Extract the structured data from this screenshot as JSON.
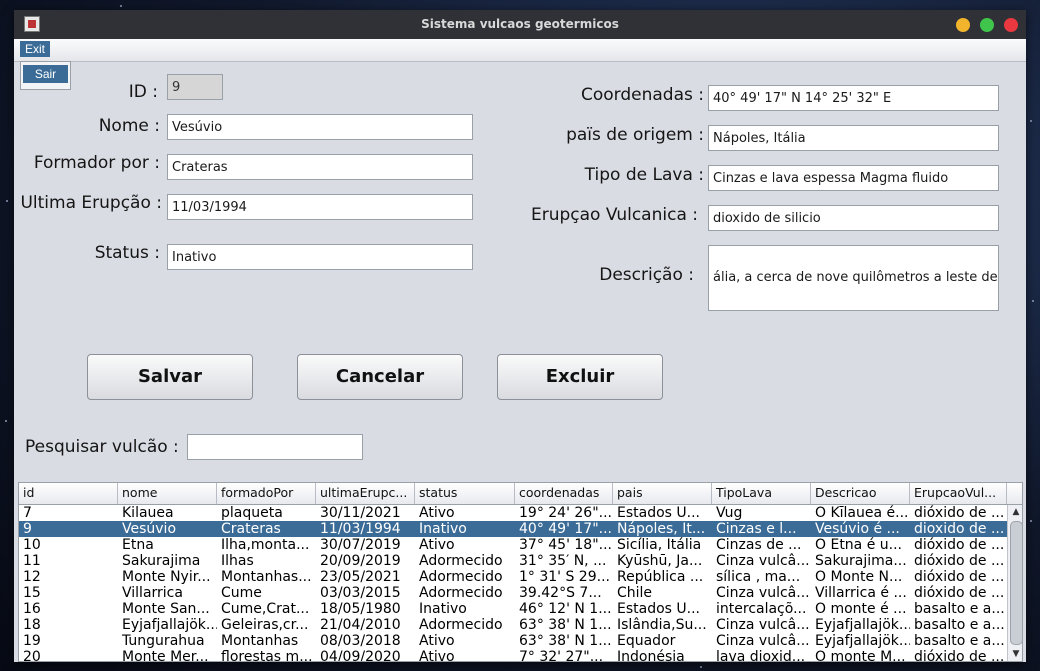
{
  "window": {
    "title": "Sistema vulcaos geotermicos"
  },
  "menu": {
    "exit_label": "Exit",
    "sair_label": "Sair"
  },
  "form": {
    "id": {
      "label": "ID :",
      "value": "9"
    },
    "nome": {
      "label": "Nome :",
      "value": "Vesúvio"
    },
    "formador": {
      "label": "Formador por :",
      "value": "Crateras"
    },
    "ultima": {
      "label": "Ultima Erupção :",
      "value": "11/03/1994"
    },
    "status": {
      "label": "Status :",
      "value": "Inativo"
    },
    "coordenadas": {
      "label": "Coordenadas :",
      "value": "40° 49' 17\" N 14° 25' 32\" E"
    },
    "pais": {
      "label": "païs de origem :",
      "value": "Nápoles, Itália"
    },
    "tipo": {
      "label": "Tipo de Lava :",
      "value": " Cinzas e lava espessa Magma fluido"
    },
    "erupcao": {
      "label": "Erupçao Vulcanica :",
      "value": "dioxido de silicio"
    },
    "descricao": {
      "label": "Descrição :",
      "value": "ália, a cerca de nove quilômetros a leste de"
    }
  },
  "buttons": {
    "salvar": "Salvar",
    "cancelar": "Cancelar",
    "excluir": "Excluir"
  },
  "search": {
    "label": "Pesquisar vulcão :",
    "value": ""
  },
  "table": {
    "columns": [
      "id",
      "nome",
      "formadoPor",
      "ultimaErupc...",
      "status",
      "coordenadas",
      "pais",
      "TipoLava",
      "Descricao",
      "ErupcaoVul..."
    ],
    "rows": [
      [
        "7",
        "Kilauea",
        "plaqueta",
        "30/11/2021",
        "Ativo",
        "19° 24' 26\"...",
        "Estados U...",
        "Vug",
        "O Kīlauea é...",
        "dióxido de ..."
      ],
      [
        "9",
        "Vesúvio",
        "Crateras",
        "11/03/1994",
        "Inativo",
        "40° 49' 17\"...",
        "Nápoles, It...",
        "Cinzas e l...",
        "Vesúvio é ...",
        "dioxido de ..."
      ],
      [
        "10",
        "Etna",
        "Ilha,monta...",
        "30/07/2019",
        "Ativo",
        "37° 45' 18\"...",
        "Sicília, Itália",
        "Cinzas de ...",
        "O Etna é u...",
        "dióxido de ..."
      ],
      [
        "11",
        "Sakurajima",
        "Ilhas",
        "20/09/2019",
        "Adormecido",
        "31° 35′ N, ...",
        "Kyūshū, Ja...",
        "Cinza vulcâ...",
        "Sakurajima...",
        "dióxido de ..."
      ],
      [
        "12",
        "Monte Nyir...",
        "Montanhas...",
        "23/05/2021",
        "Adormecido",
        "1° 31' S 29...",
        "República ...",
        "sílica , ma...",
        "O Monte N...",
        "dióxido de ..."
      ],
      [
        "15",
        "Villarrica",
        "Cume",
        "03/03/2015",
        "Adormecido",
        "39.42°S 7...",
        "Chile",
        "Cinza vulcâ...",
        "Villarrica é ...",
        "dióxido de ..."
      ],
      [
        "16",
        "Monte San...",
        "Cume,Crat...",
        "18/05/1980",
        "Inativo",
        "46° 12' N 1...",
        "Estados U...",
        "intercalaçõ...",
        "O monte é ...",
        "basalto e a..."
      ],
      [
        "18",
        "Eyjafjallajök...",
        "Geleiras,cr...",
        "21/04/2010",
        "Adormecido",
        "63° 38' N 1...",
        "Islândia,Su...",
        "Cinza vulcâ...",
        "Eyjafjallajök...",
        "basalto e a..."
      ],
      [
        "19",
        "Tungurahua",
        "Montanhas",
        "08/03/2018",
        "Ativo",
        "63° 38' N 1...",
        "Equador",
        "Cinza vulcâ...",
        "Eyjafjallajök...",
        "basalto e a..."
      ],
      [
        "20",
        "Monte Mer...",
        "florestas m...",
        "04/09/2020",
        "Ativo",
        "7° 32' 27\"...",
        "Indonésia",
        "lava dioxid...",
        "O monte M...",
        "dióxido de ..."
      ]
    ],
    "selected_row": 1
  }
}
